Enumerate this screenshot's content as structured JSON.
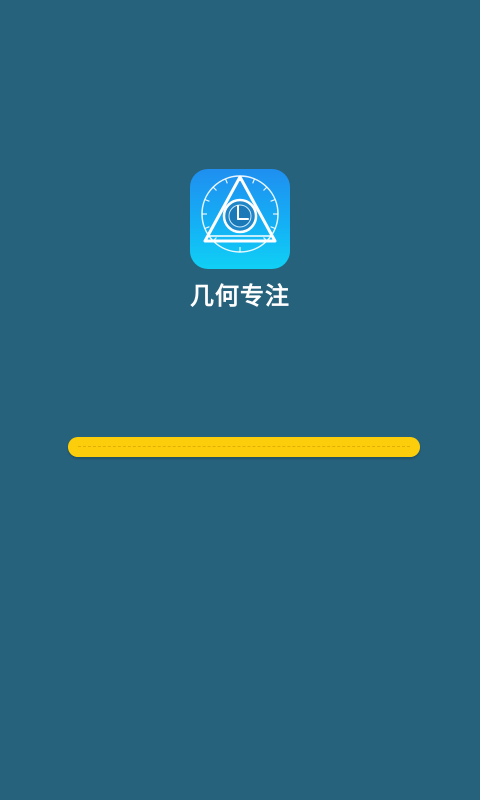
{
  "splash": {
    "app_name": "几何专注",
    "icon": "geometry-clock-icon",
    "progress": 1.0
  },
  "colors": {
    "background": "#27627d",
    "progress_bar": "#fccd0a",
    "icon_gradient_top": "#1f8ff0",
    "icon_gradient_bottom": "#10d0f5",
    "text": "#ffffff"
  }
}
